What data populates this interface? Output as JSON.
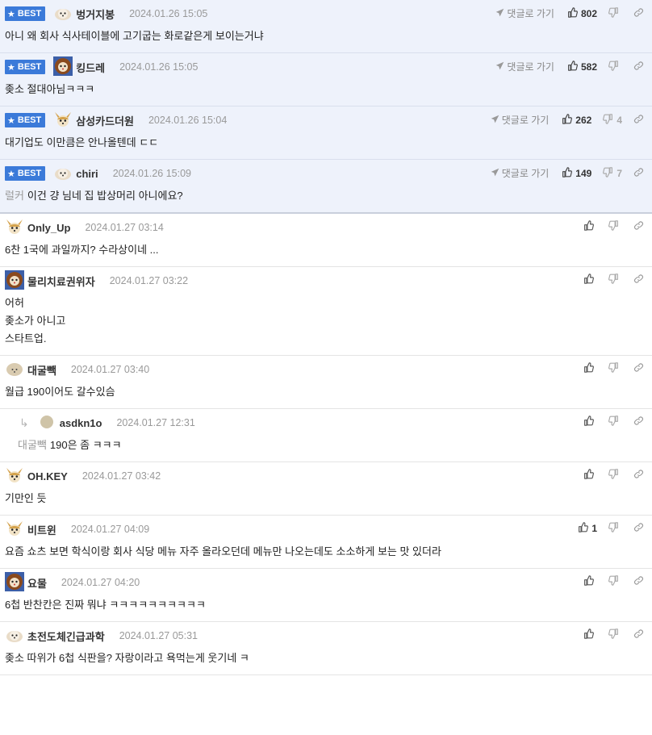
{
  "labels": {
    "best": "BEST",
    "reply_to": "댓글로 가기"
  },
  "best_comments": [
    {
      "nick": "벙거지봉",
      "date": "2024.01.26 15:05",
      "likes": "802",
      "dislikes": "",
      "text": "아니 왜 회사 식사테이블에 고기굽는 화로같은게 보이는거냐"
    },
    {
      "nick": "킹드레",
      "date": "2024.01.26 15:05",
      "likes": "582",
      "dislikes": "",
      "text": "좆소 절대아님ㅋㅋㅋ"
    },
    {
      "nick": "삼성카드더원",
      "date": "2024.01.26 15:04",
      "likes": "262",
      "dislikes": "4",
      "text": "대기업도 이만큼은 안나올텐데 ㄷㄷ"
    },
    {
      "nick": "chiri",
      "date": "2024.01.26 15:09",
      "likes": "149",
      "dislikes": "7",
      "mention": "럴커",
      "text": "이건 걍 님네 집 밥상머리 아니에요?"
    }
  ],
  "comments": [
    {
      "nick": "Only_Up",
      "date": "2024.01.27 03:14",
      "likes": "",
      "lines": [
        "6찬 1국에 과일까지? 수라상이네 ..."
      ]
    },
    {
      "nick": "물리치료권위자",
      "date": "2024.01.27 03:22",
      "likes": "",
      "lines": [
        "어허",
        "좆소가 아니고",
        "스타트업."
      ]
    },
    {
      "nick": "대굴빽",
      "date": "2024.01.27 03:40",
      "likes": "",
      "lines": [
        "월급 190이어도 갈수있슴"
      ]
    },
    {
      "nick": "asdkn1o",
      "date": "2024.01.27 12:31",
      "likes": "",
      "reply": true,
      "mention": "대굴빽",
      "lines": [
        "190은 좀 ㅋㅋㅋ"
      ]
    },
    {
      "nick": "OH.KEY",
      "date": "2024.01.27 03:42",
      "likes": "",
      "lines": [
        "기만인 듯"
      ]
    },
    {
      "nick": "비트윈",
      "date": "2024.01.27 04:09",
      "likes": "1",
      "lines": [
        "요즘 쇼츠 보면 학식이랑 회사 식당 메뉴 자주 올라오던데 메뉴만 나오는데도 소소하게 보는 맛 있더라"
      ]
    },
    {
      "nick": "요물",
      "date": "2024.01.27 04:20",
      "likes": "",
      "lines": [
        "6첩 반찬칸은 진짜 뭐냐 ㅋㅋㅋㅋㅋㅋㅋㅋㅋㅋ"
      ]
    },
    {
      "nick": "초전도체긴급과학",
      "date": "2024.01.27 05:31",
      "likes": "",
      "lines": [
        "좆소 따위가 6첩 식판을? 자랑이라고 욕먹는게 웃기네 ㅋ"
      ]
    }
  ],
  "icons": {
    "like": "thumbs-up-icon",
    "dislike": "thumbs-down-icon",
    "link": "link-icon",
    "reply": "send-arrow-icon"
  },
  "colors": {
    "best_badge": "#3b7ad9",
    "best_bg": "#eef2fb"
  }
}
